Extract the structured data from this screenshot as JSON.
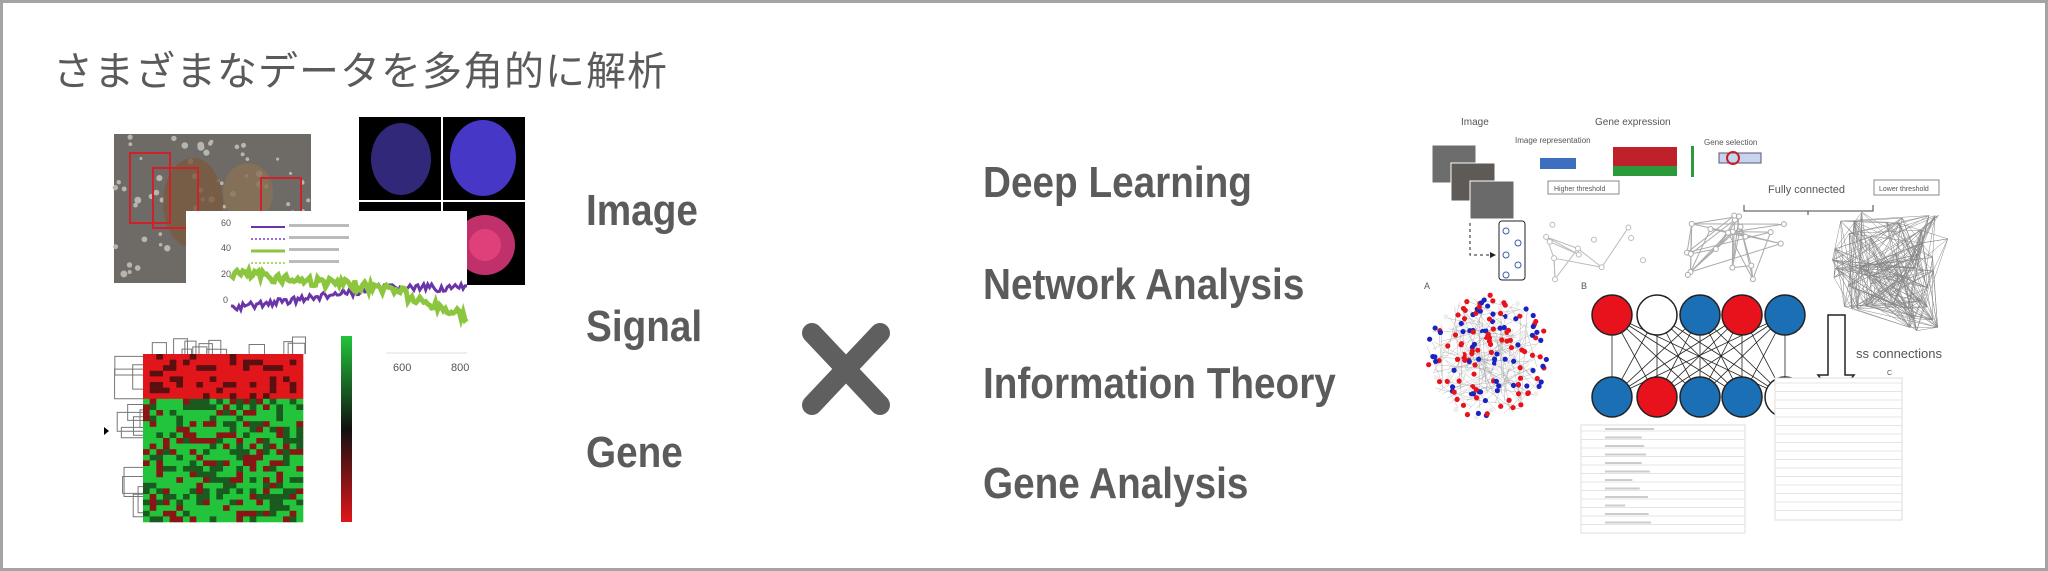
{
  "slide": {
    "title": "さまざまなデータを多角的に解析",
    "data_types": [
      "Image",
      "Signal",
      "Gene"
    ],
    "operator": "×",
    "methods": [
      "Deep Learning",
      "Network Analysis",
      "Information Theory",
      "Gene Analysis"
    ]
  },
  "left_figure": {
    "signal_y_ticks": [
      "60",
      "40",
      "20",
      "0"
    ],
    "signal_x_ticks": [
      "600",
      "800"
    ],
    "colors": {
      "purple": "#6a35a8",
      "green": "#8cc63f",
      "heat_red": "#e0161b",
      "heat_green": "#21c43a"
    }
  },
  "right_figure": {
    "image_label": "Image",
    "image_representation_label": "Image representation",
    "gene_expression_label": "Gene expression",
    "gene_selection_label": "Gene selection",
    "higher_threshold_label": "Higher threshold",
    "fully_connected_label": "Fully connected",
    "lower_threshold_label": "Lower threshold",
    "panel_a_label": "A",
    "panel_b_label": "B",
    "panel_c_label": "C",
    "connections_label": "ss connections",
    "top_row_nodes": [
      "red",
      "white",
      "blue",
      "red",
      "blue"
    ],
    "bottom_row_nodes": [
      "blue",
      "red",
      "blue",
      "blue",
      "white"
    ],
    "colors": {
      "red": "#e8121c",
      "blue": "#1b6fb5",
      "white": "#ffffff"
    }
  }
}
